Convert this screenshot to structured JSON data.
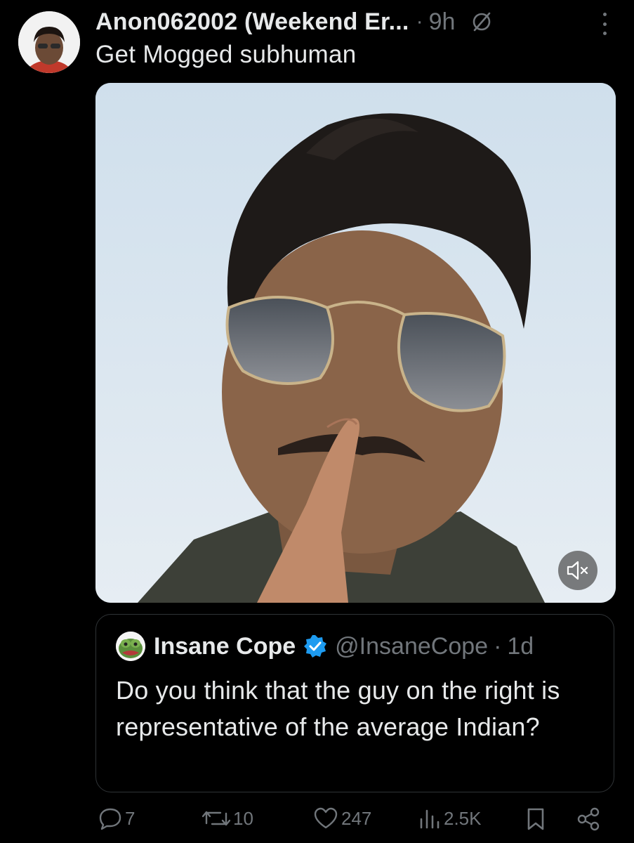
{
  "tweet": {
    "display_name": "Anon062002 (Weekend Er...",
    "separator": "·",
    "time": "9h",
    "text": "Get Mogged subhuman",
    "avatar_icon": "profile-photo",
    "media": {
      "type": "video",
      "muted_icon": "volume-mute-icon"
    }
  },
  "quote": {
    "name": "Insane Cope",
    "handle": "@InsaneCope",
    "separator": "·",
    "time": "1d",
    "verified_color": "#1d9bf0",
    "text": "Do you think that the guy on the right is representative of the average Indian?"
  },
  "actions": {
    "replies": "7",
    "reposts": "10",
    "likes": "247",
    "views": "2.5K",
    "bookmark_icon": "bookmark-icon",
    "share_icon": "share-icon"
  },
  "colors": {
    "background": "#000000",
    "text": "#e7e9ea",
    "muted": "#71767b",
    "border": "#2f3336"
  }
}
